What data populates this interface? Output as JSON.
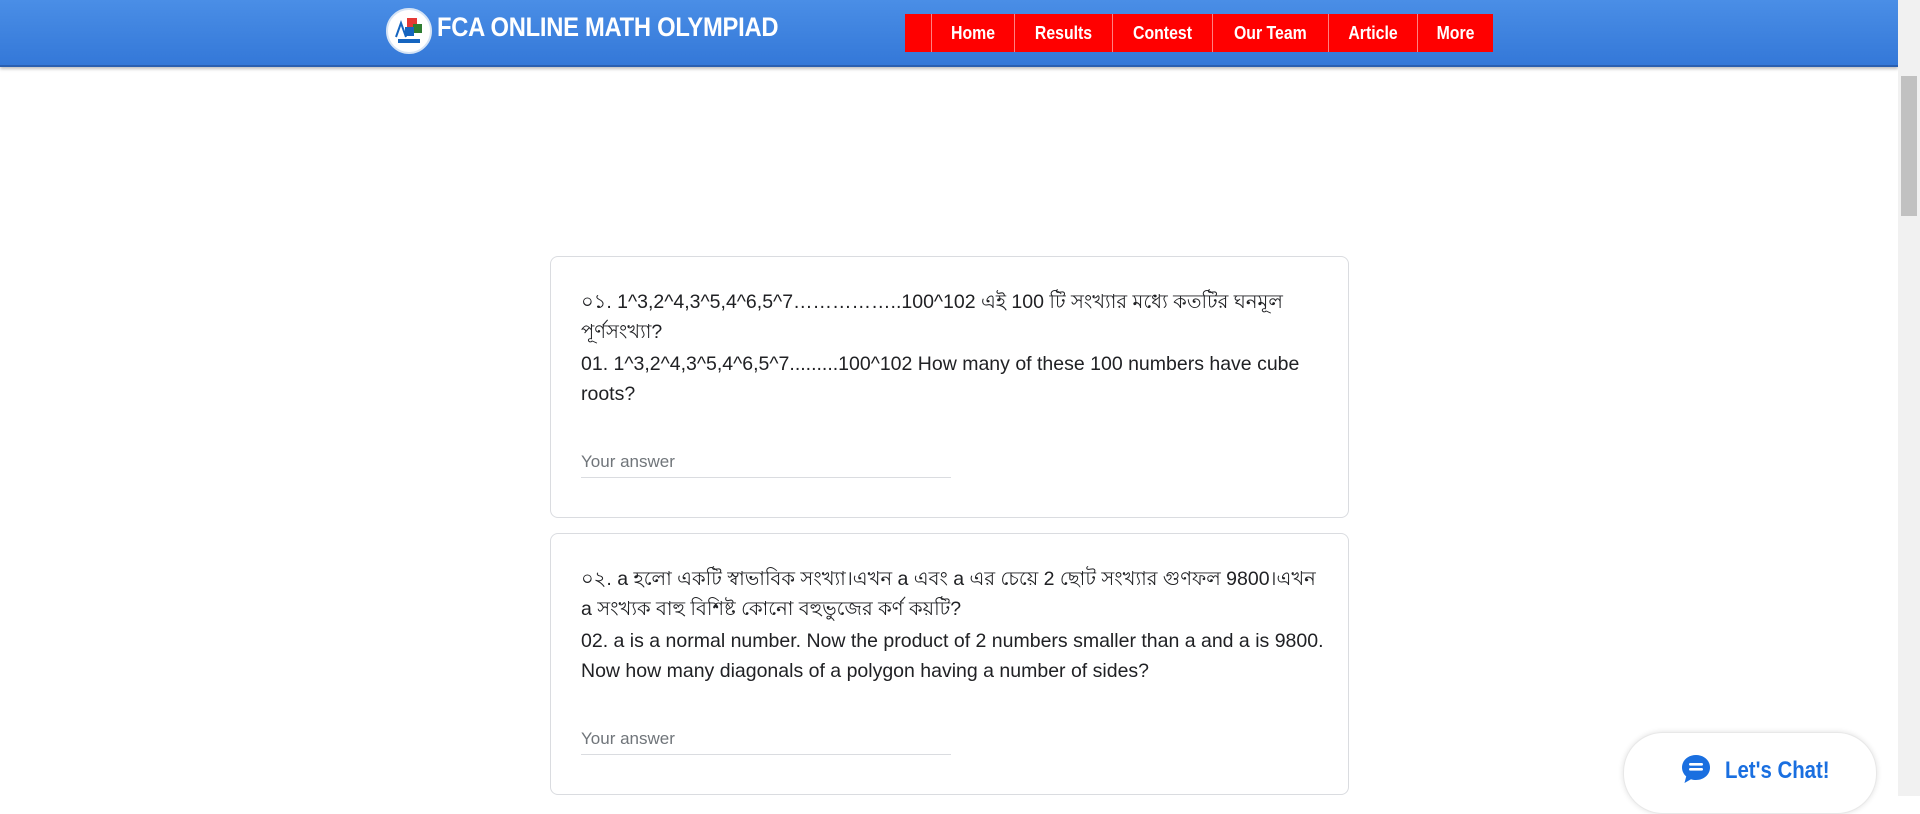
{
  "header": {
    "site_title": "FCA ONLINE MATH OLYMPIAD",
    "nav": [
      "Home",
      "Results",
      "Contest",
      "Our Team",
      "Article",
      "More"
    ]
  },
  "questions": [
    {
      "bn": "০১. 1^3,2^4,3^5,4^6,5^7……………..100^102  এই 100 টি সংখ্যার মধ্যে কতটির ঘনমূল পূর্ণসংখ্যা?",
      "en": "01. 1^3,2^4,3^5,4^6,5^7.........100^102 How many of these 100 numbers have cube roots?",
      "placeholder": "Your answer"
    },
    {
      "bn": "০২. a হলো একটি স্বাভাবিক সংখ্যা।এখন a এবং a এর চেয়ে 2 ছোট সংখ্যার গুণফল 9800।এখন a সংখ্যক বাহু বিশিষ্ট কোনো বহুভুজের কর্ণ কয়টি?",
      "en": "02. a is a normal number. Now the product of 2 numbers smaller than a and a is 9800. Now how many diagonals of a polygon having a number of sides?",
      "placeholder": "Your answer"
    }
  ],
  "chat": {
    "label": "Let's Chat!"
  },
  "colors": {
    "header": "#3a7fe0",
    "nav": "#ff0000",
    "chat": "#1a6fe0"
  },
  "icons": [
    "logo-icon",
    "chat-bubble-icon"
  ]
}
